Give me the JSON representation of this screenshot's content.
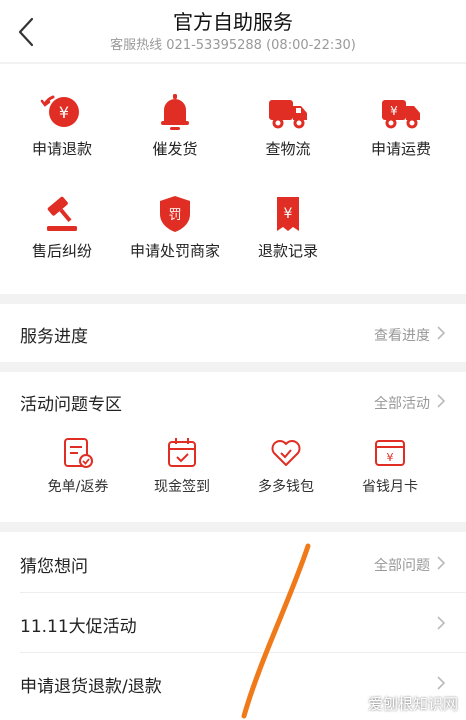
{
  "header": {
    "title": "官方自助服务",
    "hotline": "客服热线 021-53395288 (08:00-22:30)"
  },
  "services": [
    {
      "label": "申请退款",
      "icon": "refund-icon"
    },
    {
      "label": "催发货",
      "icon": "bell-icon"
    },
    {
      "label": "查物流",
      "icon": "truck-icon"
    },
    {
      "label": "申请运费",
      "icon": "freight-truck-icon"
    },
    {
      "label": "售后纠纷",
      "icon": "gavel-icon"
    },
    {
      "label": "申请处罚商家",
      "icon": "penalty-shield-icon"
    },
    {
      "label": "退款记录",
      "icon": "refund-record-icon"
    }
  ],
  "progress": {
    "title": "服务进度",
    "more": "查看进度"
  },
  "activity": {
    "title": "活动问题专区",
    "more": "全部活动",
    "items": [
      {
        "label": "免单/返券",
        "icon": "coupon-icon"
      },
      {
        "label": "现金签到",
        "icon": "calendar-check-icon"
      },
      {
        "label": "多多钱包",
        "icon": "heart-wallet-icon"
      },
      {
        "label": "省钱月卡",
        "icon": "yuan-card-icon"
      }
    ]
  },
  "faq": {
    "title": "猜您想问",
    "more": "全部问题",
    "items": [
      {
        "label": "11.11大促活动"
      },
      {
        "label": "申请退货退款/退款"
      }
    ]
  },
  "watermark": "爱刨根知识网",
  "colors": {
    "accent": "#e02e24",
    "overlay_stroke": "#f07a1a"
  }
}
